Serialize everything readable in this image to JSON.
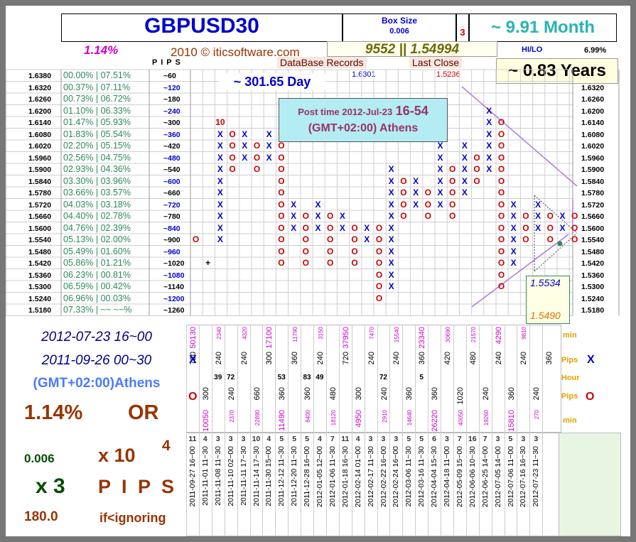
{
  "header": {
    "symbol": "GBPUSD30",
    "box_size_label": "Box Size",
    "box_size_value": "0.006",
    "reversal": "3",
    "months": "~ 9.91 Month",
    "years": "~ 0.83 Years",
    "days": "~ 301.65 Day",
    "percent_top": "1.14%",
    "copyright": "2010 © iticsoftware.com",
    "record_count": "9552",
    "last_price": "1.54994",
    "db_label": "DataBase Records",
    "last_close_label": "Last Close",
    "db_value": "1.6301",
    "last_close_value": "1.5236",
    "hilo_label": "HI/LO",
    "hilo_value": "6.99%",
    "pips_label": "P I P S"
  },
  "post_time": {
    "line1": "Post time 2012-Jul-23",
    "time": "16-54",
    "tz": "(GMT+02:00) Athens"
  },
  "chart_data": {
    "type": "point-and-figure",
    "box_size": 0.006,
    "reversal": 3,
    "price_levels": [
      "1.6380",
      "1.6320",
      "1.6260",
      "1.6200",
      "1.6140",
      "1.6080",
      "1.6020",
      "1.5960",
      "1.5900",
      "1.5840",
      "1.5780",
      "1.5720",
      "1.5660",
      "1.5600",
      "1.5540",
      "1.5480",
      "1.5420",
      "1.5360",
      "1.5300",
      "1.5240",
      "1.5180"
    ],
    "left_pct": [
      "00.00% | 07.51%",
      "00.37% | 07.11%",
      "00.73% | 06.72%",
      "01.10% | 06.33%",
      "01.47% | 05.93%",
      "01.83% | 05.54%",
      "02.20% | 05.15%",
      "02.56% | 04.75%",
      "02.93% | 04.36%",
      "03.30% | 03.96%",
      "03.66% | 03.57%",
      "04.03% | 03.18%",
      "04.40% | 02.78%",
      "04.76% | 02.39%",
      "05.13% | 02.00%",
      "05.49% | 01.60%",
      "05.86% | 01.21%",
      "06.23% | 00.81%",
      "06.59% | 00.42%",
      "06.96% | 00.03%",
      "07.33% | ~~ ~~%"
    ],
    "pips": [
      "~60",
      "~120",
      "~180",
      "~240",
      "~300",
      "~360",
      "~420",
      "~480",
      "~540",
      "~600",
      "~660",
      "~720",
      "~780",
      "~840",
      "~900",
      "~960",
      "~1020",
      "~1080",
      "~1140",
      "~1200",
      "~1260"
    ],
    "right_levels": [
      "1.6320",
      "1.6260",
      "1.6200",
      "1.6140",
      "1.6080",
      "1.6020",
      "1.5960",
      "1.5900",
      "1.5840",
      "1.5780",
      "1.5720",
      "1.5660",
      "1.5600",
      "1.5540",
      "1.5480",
      "1.5420",
      "1.5360",
      "1.5300",
      "1.5240",
      "1.5180"
    ],
    "columns": [
      {
        "type": "O",
        "top": 1.554,
        "bottom": 1.554
      },
      {
        "type": "+",
        "top": 1.542,
        "bottom": 1.542
      },
      {
        "type": "X",
        "top": 1.614,
        "bottom": 1.554,
        "label_top": "10"
      },
      {
        "type": "O",
        "top": 1.608,
        "bottom": 1.59
      },
      {
        "type": "X",
        "top": 1.608,
        "bottom": 1.596
      },
      {
        "type": "O",
        "top": 1.602,
        "bottom": 1.59
      },
      {
        "type": "X",
        "top": 1.608,
        "bottom": 1.596
      },
      {
        "type": "O",
        "top": 1.608,
        "bottom": 1.542
      },
      {
        "type": "X",
        "top": 1.572,
        "bottom": 1.56
      },
      {
        "type": "O",
        "top": 1.566,
        "bottom": 1.542
      },
      {
        "type": "X",
        "top": 1.572,
        "bottom": 1.56
      },
      {
        "type": "O",
        "top": 1.566,
        "bottom": 1.542
      },
      {
        "type": "X",
        "top": 1.566,
        "bottom": 1.56
      },
      {
        "type": "O",
        "top": 1.56,
        "bottom": 1.542
      },
      {
        "type": "X",
        "top": 1.56,
        "bottom": 1.554
      },
      {
        "type": "O",
        "top": 1.56,
        "bottom": 1.524
      },
      {
        "type": "X",
        "top": 1.59,
        "bottom": 1.53
      },
      {
        "type": "O",
        "top": 1.584,
        "bottom": 1.566
      },
      {
        "type": "X",
        "top": 1.584,
        "bottom": 1.572
      },
      {
        "type": "O",
        "top": 1.578,
        "bottom": 1.566
      },
      {
        "type": "X",
        "top": 1.602,
        "bottom": 1.572
      },
      {
        "type": "O",
        "top": 1.59,
        "bottom": 1.566
      },
      {
        "type": "X",
        "top": 1.602,
        "bottom": 1.578
      },
      {
        "type": "O",
        "top": 1.596,
        "bottom": 1.584
      },
      {
        "type": "X",
        "top": 1.62,
        "bottom": 1.59
      },
      {
        "type": "O",
        "top": 1.614,
        "bottom": 1.53
      },
      {
        "type": "X",
        "top": 1.572,
        "bottom": 1.542
      },
      {
        "type": "O",
        "top": 1.566,
        "bottom": 1.554
      },
      {
        "type": "X",
        "top": 1.572,
        "bottom": 1.56
      },
      {
        "type": "O",
        "top": 1.566,
        "bottom": 1.554
      },
      {
        "type": "X",
        "top": 1.566,
        "bottom": 1.56
      },
      {
        "type": "O",
        "top": 1.566,
        "bottom": 1.554
      }
    ],
    "target_up": "1.5534",
    "target_down": "1.5490"
  },
  "bottom_left": {
    "date1": "2012-07-23 16~00",
    "date2": "2011-09-26 00~30",
    "tz": "(GMT+02:00)Athens",
    "pct": "1.14%",
    "or": "OR",
    "box": "0.006",
    "x10": "x 10",
    "exp": "4",
    "x3": "x 3",
    "pips": "P I P S",
    "total": "180.0",
    "ignoring": "if<ignoring"
  },
  "stats": {
    "min_label": "min",
    "pips_label": "Pips",
    "hour_label": "Hour",
    "x_symbol": "X",
    "o_symbol": "O",
    "x_min": [
      "50130",
      "2340",
      "4320",
      "17100",
      "11790",
      "3150",
      "37950",
      "7470",
      "15540",
      "23340",
      "30690",
      "21570",
      "4290",
      "9810"
    ],
    "x_pips": [
      "720",
      "240",
      "240",
      "300",
      "360",
      "240",
      "720",
      "240",
      "240",
      "360",
      "420",
      "480",
      "240",
      "240",
      "360"
    ],
    "hours": [
      "",
      "",
      "39",
      "72",
      "",
      "",
      "",
      "53",
      "",
      "83",
      "49",
      "",
      "",
      "",
      "",
      "72",
      "",
      "",
      "5"
    ],
    "o_pips": [
      "300",
      "240",
      "660",
      "360",
      "360",
      "480",
      "300",
      "240",
      "360",
      "360",
      "1020",
      "240",
      "360",
      "240"
    ],
    "o_min": [
      "10050",
      "2370",
      "22890",
      "11490",
      "8400",
      "18120",
      "4950",
      "2910",
      "14640",
      "26220",
      "40050",
      "19260",
      "15810",
      "270"
    ],
    "counts": [
      "11",
      "4",
      "3",
      "3",
      "3",
      "10",
      "4",
      "5",
      "5",
      "5",
      "4",
      "7",
      "11",
      "4",
      "3",
      "3",
      "3",
      "5",
      "5",
      "6",
      "3",
      "7",
      "16",
      "7",
      "3",
      "5",
      "3",
      "3"
    ],
    "dates": [
      "2011-09-27 16~00",
      "2011-11-01 11~30",
      "2011-11-08 11~30",
      "2011-11-10 02~00",
      "2011-11-11 17~30",
      "2011-11-14 17~30",
      "2011-11-30 15~00",
      "2011-12-12 11~30",
      "2011-12-20 11~30",
      "2011-12-28 16~00",
      "2012-01-05 12~00",
      "2012-01-06 11~30",
      "2012-01-18 16~30",
      "2012-02-14 01~00",
      "2012-02-17 11~30",
      "2012-02-22 16~00",
      "2012-02-24 16~00",
      "2012-03-06 11~30",
      "2012-03-16 11~30",
      "2012-04-04 15~30",
      "2012-04-18 11~00",
      "2012-05-09 15~00",
      "2012-06-06 10~30",
      "2012-06-25 14~00",
      "2012-07-05 14~00",
      "2012-07-06 11~00",
      "2012-07-16 16~30",
      "2012-07-23 11~30"
    ]
  },
  "colors": {
    "x": "#0000cc",
    "o": "#cc0000",
    "plus": "#000000",
    "green": "#2e8b57",
    "magenta": "#cc00cc",
    "brown": "#993300",
    "blue_text": "#0000cc"
  }
}
